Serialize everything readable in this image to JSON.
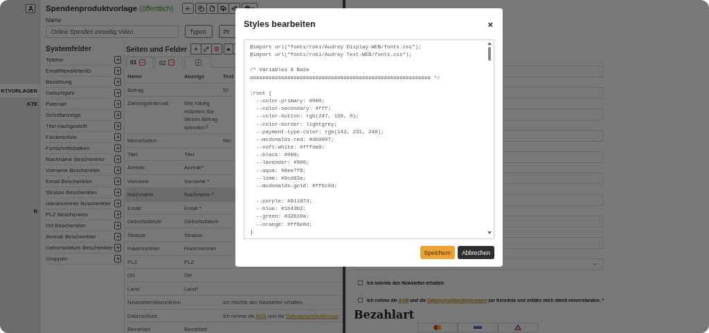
{
  "sidebar": {
    "items": [
      {
        "label": "KTVORLAGEN",
        "selected": true
      },
      {
        "label": "KTE",
        "selected": false
      }
    ],
    "bottom_items": [
      {
        "label": "N",
        "selected": false
      }
    ]
  },
  "header": {
    "title": "Spendenproduktvorlage",
    "status": "(öffentlich)"
  },
  "name_field": {
    "label": "Name",
    "value": "Online Spenden einseitig Video"
  },
  "header_buttons": [
    {
      "label": "Typen",
      "kind": "dropdown"
    },
    {
      "label": "Pr",
      "kind": "plain"
    }
  ],
  "system_fields": {
    "title": "Systemfelder",
    "items": [
      "Telefon",
      "EmailNewsletterID",
      "Bezahlung",
      "Geburtsjahr",
      "Patenart",
      "Schrittanzeige",
      "Titel nachgestellt",
      "Fördererliste",
      "Fortschrittsbalken",
      "Nachname Beschenkter",
      "Vorname Beschenkter",
      "Email Beschenkter",
      "Strasse Beschenkter",
      "Hausnummer Beschenkter",
      "PLZ Beschenkter",
      "Ort Beschenkter",
      "Anrede Beschenkter",
      "Geburtsdatum Beschenkter",
      "Gruppen"
    ]
  },
  "pages": {
    "title": "Seiten und Felder",
    "tabs": [
      {
        "label": "01",
        "selected": true
      },
      {
        "label": "02",
        "selected": false
      }
    ],
    "columns": [
      "Name",
      "Anzeige",
      "Text"
    ],
    "rows": [
      {
        "name": "Betrag",
        "text": [
          {
            "text": "52"
          }
        ],
        "selected": false
      },
      {
        "name": "Zahlungsintervall",
        "display": "Wie häufig möchten Sie diesen Betrag spenden?",
        "selected": false
      },
      {
        "name": "MeineDaten",
        "text": [
          {
            "text": "Mei"
          }
        ],
        "selected": false
      },
      {
        "name": "Titel",
        "display": "Titel",
        "selected": false
      },
      {
        "name": "Anrede",
        "display": "Anrede*",
        "selected": false
      },
      {
        "name": "Vorname",
        "display": "Vorname *",
        "selected": false
      },
      {
        "name": "Nachname",
        "display": "Nachname *",
        "selected": true
      },
      {
        "name": "Email",
        "display": "Email *",
        "selected": false
      },
      {
        "name": "Geburtsdatum",
        "display": "Geburtsdatum",
        "selected": false
      },
      {
        "name": "Strasse",
        "display": "Strasse",
        "selected": false
      },
      {
        "name": "Hausnummer",
        "display": "Hausnummer",
        "selected": false
      },
      {
        "name": "PLZ",
        "display": "PLZ",
        "selected": false
      },
      {
        "name": "Ort",
        "display": "Ort",
        "selected": false
      },
      {
        "name": "Land",
        "display": "Land*",
        "selected": false
      },
      {
        "name": "NewsletterAbonnieren",
        "text": [
          {
            "text": "Ich möchte den Newsletter erhalten"
          }
        ],
        "selected": false
      },
      {
        "name": "Datenschutz",
        "text": [
          {
            "text": "Ich nehme die "
          },
          {
            "text": "AGB",
            "kind": "link"
          },
          {
            "text": " und die "
          },
          {
            "text": "Datenschutzbestimmun",
            "kind": "link"
          }
        ],
        "selected": false
      },
      {
        "name": "Bezahlart",
        "display": "Bezahlart",
        "selected": false
      }
    ]
  },
  "form": {
    "fields": [
      {
        "kind": "input"
      },
      {
        "kind": "input"
      },
      {
        "kind": "input"
      },
      {
        "kind": "input"
      },
      {
        "kind": "input"
      },
      {
        "kind": "input"
      },
      {
        "kind": "input"
      },
      {
        "kind": "input"
      },
      {
        "kind": "input"
      },
      {
        "kind": "select"
      }
    ],
    "checkboxes": [
      {
        "checked": false,
        "parts": [
          {
            "text": "Ich möchte den Newsletter erhalten"
          }
        ]
      },
      {
        "checked": false,
        "parts": [
          {
            "text": "Ich nehme die "
          },
          {
            "text": "AGB",
            "kind": "link"
          },
          {
            "text": " und die "
          },
          {
            "text": "Datenschutzbestimmungen",
            "kind": "link"
          },
          {
            "text": " zur Kenntnis und erkläre mich damit einverstanden. *"
          }
        ]
      }
    ],
    "heading": "Bezahlart",
    "payment_options": [
      {
        "kind": "card"
      },
      {
        "kind": "wallet"
      },
      {
        "kind": "transfer"
      }
    ]
  },
  "modal": {
    "title": "Styles bearbeiten",
    "close": "×",
    "code": "@import url(\"fonts/roki/Audrey Display-WEB/fonts.css\");\n@import url(\"fonts/roki/Audrey Text-WEB/fonts.css\");\n\n/* Variables & Base\n########################################################## */\n\n:root {\n  --color-primary: #000;\n  --color-secondary: #fff;\n  --color-button: rgb(247, 150, 0);\n  --color-border: lightgrey;\n  --payment-type-color: rgb(142, 231, 248);\n  --mcdonalds-red: #db0007;\n  --soft-white: #fffde9;\n  --black: #000;\n  --lavender: #000;\n  --aqua: #8ee7f8;\n  --lime: #9cd83e;\n  --mcdonalds-gold: #ffbc0d;\n\n  --purple: #91187d;\n  --blue: #1b43b2;\n  --green: #32610a;\n  --orange: #ff6e0d;\n}",
    "buttons": [
      {
        "label": "Speichern",
        "kind": "primary"
      },
      {
        "label": "Abbrechen",
        "kind": "secondary"
      }
    ]
  }
}
